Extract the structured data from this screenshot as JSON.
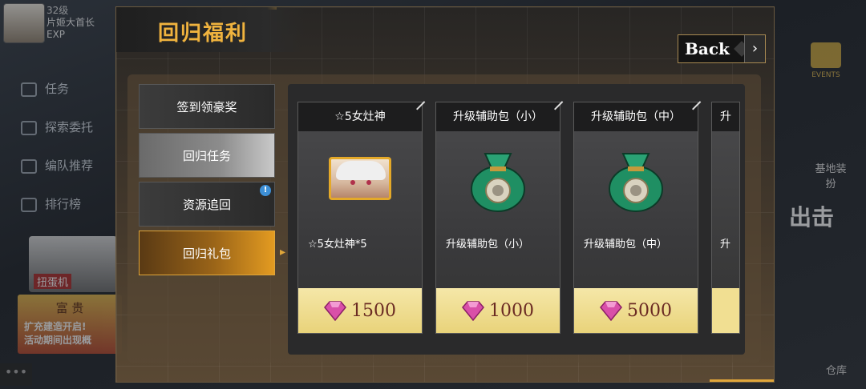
{
  "background": {
    "level": "32级",
    "player_name": "片姬大首长",
    "exp_label": "EXP",
    "menu": [
      "任务",
      "探索委托",
      "编队推荐",
      "排行榜"
    ],
    "events_label": "EVENTS",
    "base_label": "基地装扮",
    "battle_label": "出击",
    "depot_label": "仓库",
    "gacha_label": "扭蛋机",
    "promo_title": "富 贵",
    "promo_line1": "扩充建造开启!",
    "promo_line2": "活动期间出现概"
  },
  "modal": {
    "title": "回归福利",
    "back_label": "Back",
    "tabs": [
      {
        "label": "签到领豪奖",
        "style": "dark"
      },
      {
        "label": "回归任务",
        "style": "light"
      },
      {
        "label": "资源追回",
        "style": "dark",
        "badge": "!"
      },
      {
        "label": "回归礼包",
        "style": "active"
      }
    ],
    "cards": [
      {
        "title": "☆5女灶神",
        "item": "☆5女灶神*5",
        "price": "1500",
        "image": "portrait"
      },
      {
        "title": "升级辅助包（小）",
        "item": "升级辅助包（小）",
        "price": "1000",
        "image": "bag"
      },
      {
        "title": "升级辅助包（中）",
        "item": "升级辅助包（中）",
        "price": "5000",
        "image": "bag"
      }
    ],
    "partial_card": {
      "title": "升",
      "item": "升"
    }
  },
  "colors": {
    "accent": "#e0a63a",
    "price_text": "#6b2b23",
    "gem": "#d94fa8",
    "bag": "#1f8f63"
  },
  "icons": {
    "gem": "gem-icon",
    "bag": "money-bag-icon",
    "back": "chevron-right-icon"
  }
}
